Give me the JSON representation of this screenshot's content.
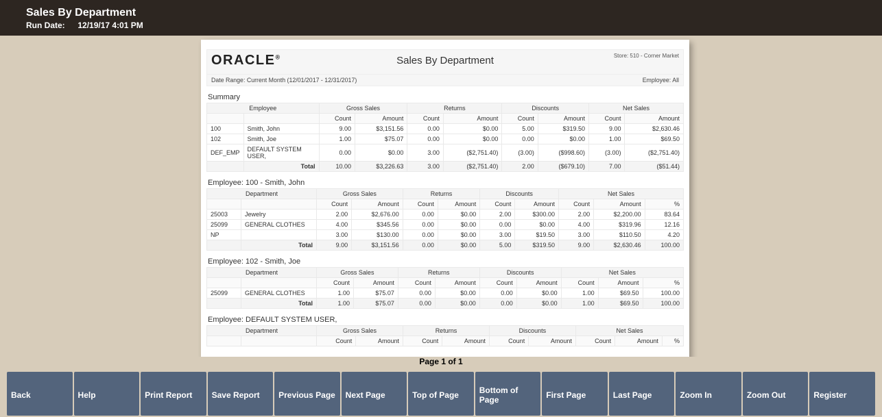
{
  "topbar": {
    "title": "Sales By Department",
    "run_label": "Run Date:",
    "run_value": "12/19/17 4:01 PM"
  },
  "pager": {
    "text": "Page 1 of 1"
  },
  "buttons": {
    "back": "Back",
    "help": "Help",
    "print": "Print Report",
    "save": "Save Report",
    "prev": "Previous Page",
    "next": "Next Page",
    "top": "Top of Page",
    "bottom": "Bottom of Page",
    "first": "First Page",
    "last": "Last Page",
    "zoomin": "Zoom In",
    "zoomout": "Zoom Out",
    "register": "Register"
  },
  "report": {
    "logo": "ORACLE",
    "title": "Sales By Department",
    "store": "Store: 510 - Corner Market",
    "date_range_label": "Date Range:",
    "date_range_value": "Current Month (12/01/2017 - 12/31/2017)",
    "employee_filter_label": "Employee:",
    "employee_filter_value": "All",
    "summary_title": "Summary",
    "group_headers": {
      "employee": "Employee",
      "department": "Department",
      "gross": "Gross Sales",
      "returns": "Returns",
      "discounts": "Discounts",
      "net": "Net Sales"
    },
    "sub_headers": {
      "count": "Count",
      "amount": "Amount",
      "pct": "%"
    },
    "total_label": "Total",
    "summary_rows": [
      {
        "id": "100",
        "name": "Smith, John",
        "gc": "9.00",
        "ga": "$3,151.56",
        "rc": "0.00",
        "ra": "$0.00",
        "dc": "5.00",
        "da": "$319.50",
        "nc": "9.00",
        "na": "$2,630.46"
      },
      {
        "id": "102",
        "name": "Smith, Joe",
        "gc": "1.00",
        "ga": "$75.07",
        "rc": "0.00",
        "ra": "$0.00",
        "dc": "0.00",
        "da": "$0.00",
        "nc": "1.00",
        "na": "$69.50"
      },
      {
        "id": "DEF_EMP",
        "name": "DEFAULT SYSTEM USER,",
        "gc": "0.00",
        "ga": "$0.00",
        "rc": "3.00",
        "ra": "($2,751.40)",
        "dc": "(3.00)",
        "da": "($998.60)",
        "nc": "(3.00)",
        "na": "($2,751.40)"
      }
    ],
    "summary_total": {
      "gc": "10.00",
      "ga": "$3,226.63",
      "rc": "3.00",
      "ra": "($2,751.40)",
      "dc": "2.00",
      "da": "($679.10)",
      "nc": "7.00",
      "na": "($51.44)"
    },
    "sections": [
      {
        "title": "Employee: 100  -  Smith, John",
        "rows": [
          {
            "id": "25003",
            "name": "Jewelry",
            "gc": "2.00",
            "ga": "$2,676.00",
            "rc": "0.00",
            "ra": "$0.00",
            "dc": "2.00",
            "da": "$300.00",
            "nc": "2.00",
            "na": "$2,200.00",
            "pct": "83.64"
          },
          {
            "id": "25099",
            "name": "GENERAL CLOTHES",
            "gc": "4.00",
            "ga": "$345.56",
            "rc": "0.00",
            "ra": "$0.00",
            "dc": "0.00",
            "da": "$0.00",
            "nc": "4.00",
            "na": "$319.96",
            "pct": "12.16"
          },
          {
            "id": "NP",
            "name": "",
            "gc": "3.00",
            "ga": "$130.00",
            "rc": "0.00",
            "ra": "$0.00",
            "dc": "3.00",
            "da": "$19.50",
            "nc": "3.00",
            "na": "$110.50",
            "pct": "4.20"
          }
        ],
        "total": {
          "gc": "9.00",
          "ga": "$3,151.56",
          "rc": "0.00",
          "ra": "$0.00",
          "dc": "5.00",
          "da": "$319.50",
          "nc": "9.00",
          "na": "$2,630.46",
          "pct": "100.00"
        }
      },
      {
        "title": "Employee: 102  -  Smith, Joe",
        "rows": [
          {
            "id": "25099",
            "name": "GENERAL CLOTHES",
            "gc": "1.00",
            "ga": "$75.07",
            "rc": "0.00",
            "ra": "$0.00",
            "dc": "0.00",
            "da": "$0.00",
            "nc": "1.00",
            "na": "$69.50",
            "pct": "100.00"
          }
        ],
        "total": {
          "gc": "1.00",
          "ga": "$75.07",
          "rc": "0.00",
          "ra": "$0.00",
          "dc": "0.00",
          "da": "$0.00",
          "nc": "1.00",
          "na": "$69.50",
          "pct": "100.00"
        }
      },
      {
        "title": "Employee: DEFAULT SYSTEM USER,",
        "rows": [],
        "total": null
      }
    ]
  }
}
